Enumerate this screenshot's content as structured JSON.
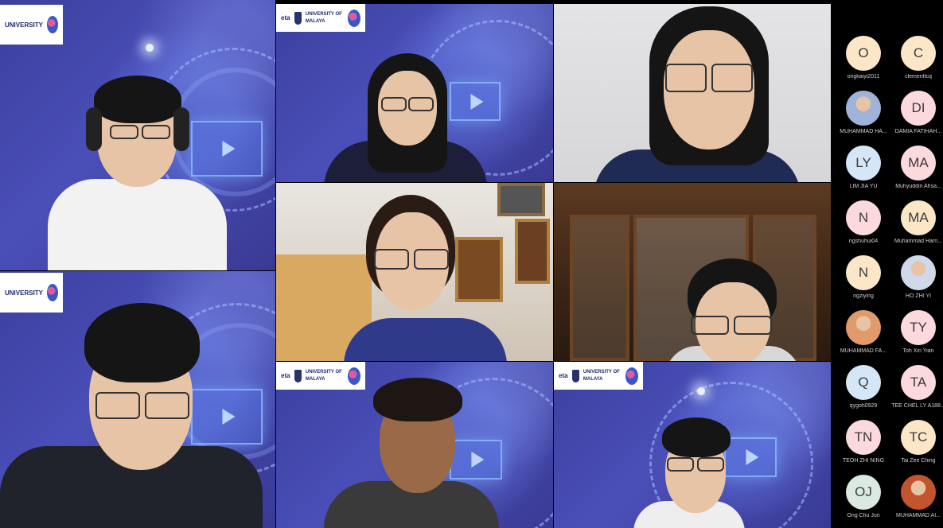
{
  "video_tiles": [
    {
      "id": "tile-1",
      "logo": {
        "lines": [
          "UNIVERSITY",
          "DIGITECS"
        ]
      }
    },
    {
      "id": "tile-2",
      "logo": {
        "lines": [
          "eta",
          "UNIVERSITY OF MALAYA",
          "DIGITECS"
        ]
      }
    },
    {
      "id": "tile-3"
    },
    {
      "id": "tile-4",
      "logo": {
        "lines": [
          "UNIVERSITY",
          "DIGITECS"
        ]
      }
    },
    {
      "id": "tile-5"
    },
    {
      "id": "tile-6"
    },
    {
      "id": "tile-7",
      "logo": {
        "lines": [
          "eta",
          "UNIVERSITY OF MALAYA",
          "DIGITECS"
        ]
      }
    },
    {
      "id": "tile-8",
      "logo": {
        "lines": [
          "eta",
          "UNIVERSITY OF MALAYA",
          "DIGITECS"
        ]
      }
    }
  ],
  "participants": [
    {
      "initials": "O",
      "name": "ongkaiyi2011",
      "color": "#fbe7c8"
    },
    {
      "initials": "C",
      "name": "clementtcq",
      "color": "#fbe7c8"
    },
    {
      "initials": "",
      "name": "MUHAMMAD HA...",
      "color": "#9fb3d9",
      "photo": true
    },
    {
      "initials": "DI",
      "name": "DAMIA FATIHAH...",
      "color": "#fcd9dd"
    },
    {
      "initials": "LY",
      "name": "LIM JIA YU",
      "color": "#d5e6f7"
    },
    {
      "initials": "MA",
      "name": "Muhyuddin Ahsa...",
      "color": "#fcd9dd"
    },
    {
      "initials": "N",
      "name": "ngshuhui04",
      "color": "#fcd9dd"
    },
    {
      "initials": "MA",
      "name": "Muhammad Harri...",
      "color": "#fbe7c8"
    },
    {
      "initials": "N",
      "name": "ngziying",
      "color": "#fbe7c8"
    },
    {
      "initials": "",
      "name": "HO ZHI YI",
      "color": "#cfd9ea",
      "photo": true
    },
    {
      "initials": "",
      "name": "MUHAMMAD FA...",
      "color": "#e09a6b",
      "photo": true
    },
    {
      "initials": "TY",
      "name": "Toh Xin Yian",
      "color": "#fcd9dd"
    },
    {
      "initials": "Q",
      "name": "qygoh0929",
      "color": "#d5e6f7"
    },
    {
      "initials": "TA",
      "name": "TEE CHEL LY A188...",
      "color": "#fcd9dd"
    },
    {
      "initials": "TN",
      "name": "TEOH ZHI NING",
      "color": "#fcd9dd"
    },
    {
      "initials": "TC",
      "name": "Tai Zee Ching",
      "color": "#fbe7c8"
    },
    {
      "initials": "OJ",
      "name": "Ong Chu Jun",
      "color": "#dce9e2"
    },
    {
      "initials": "",
      "name": "MUHAMMAD AI...",
      "color": "#c2542e",
      "photo": true
    }
  ]
}
